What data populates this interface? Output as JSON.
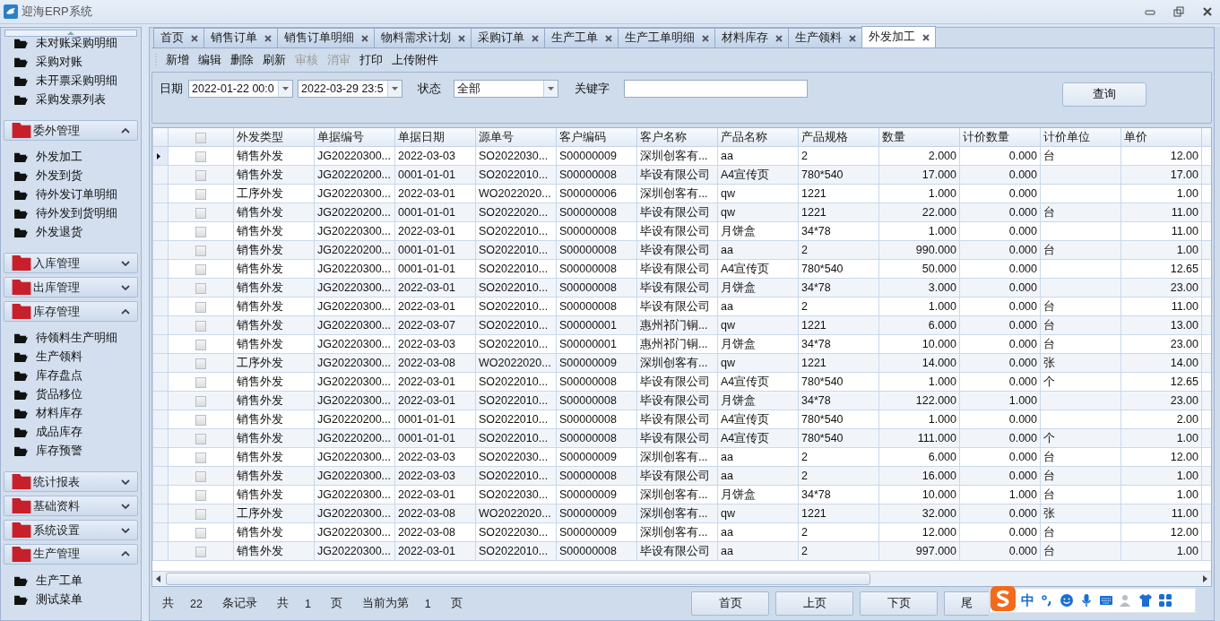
{
  "window": {
    "title": "迎海ERP系统"
  },
  "sidebar": {
    "top_items": [
      "未对账采购明细",
      "采购对账",
      "未开票采购明细",
      "采购发票列表"
    ],
    "groups": [
      {
        "label": "委外管理",
        "expanded": true,
        "items": [
          "外发加工",
          "外发到货",
          "待外发订单明细",
          "待外发到货明细",
          "外发退货"
        ]
      },
      {
        "label": "入库管理",
        "expanded": false
      },
      {
        "label": "出库管理",
        "expanded": false
      },
      {
        "label": "库存管理",
        "expanded": true,
        "items": [
          "待领料生产明细",
          "生产领料",
          "库存盘点",
          "货品移位",
          "材料库存",
          "成品库存",
          "库存预警"
        ]
      },
      {
        "label": "统计报表",
        "expanded": false
      },
      {
        "label": "基础资料",
        "expanded": false
      },
      {
        "label": "系统设置",
        "expanded": false
      },
      {
        "label": "生产管理",
        "expanded": true,
        "items": [
          "生产工单",
          "测试菜单"
        ]
      }
    ]
  },
  "tabs": [
    {
      "label": "首页",
      "selected": false
    },
    {
      "label": "销售订单",
      "selected": false
    },
    {
      "label": "销售订单明细",
      "selected": false
    },
    {
      "label": "物料需求计划",
      "selected": false
    },
    {
      "label": "采购订单",
      "selected": false
    },
    {
      "label": "生产工单",
      "selected": false
    },
    {
      "label": "生产工单明细",
      "selected": false
    },
    {
      "label": "材料库存",
      "selected": false
    },
    {
      "label": "生产领料",
      "selected": false
    },
    {
      "label": "外发加工",
      "selected": true
    }
  ],
  "toolbar": [
    {
      "label": "新增",
      "disabled": false
    },
    {
      "label": "编辑",
      "disabled": false
    },
    {
      "label": "删除",
      "disabled": false
    },
    {
      "label": "刷新",
      "disabled": false
    },
    {
      "label": "审核",
      "disabled": true
    },
    {
      "label": "消审",
      "disabled": true
    },
    {
      "label": "打印",
      "disabled": false
    },
    {
      "label": "上传附件",
      "disabled": false
    }
  ],
  "filter": {
    "date_label": "日期",
    "date_from": "2022-01-22 00:0",
    "date_to": "2022-03-29 23:5",
    "status_label": "状态",
    "status": "全部",
    "keyword_label": "关键字",
    "query_button": "查询"
  },
  "table": {
    "header_checked": false,
    "columns": [
      {
        "label": "外发类型",
        "kind": "text"
      },
      {
        "label": "单据编号",
        "kind": "text"
      },
      {
        "label": "单据日期",
        "kind": "text"
      },
      {
        "label": "源单号",
        "kind": "text"
      },
      {
        "label": "客户编码",
        "kind": "text"
      },
      {
        "label": "客户名称",
        "kind": "text"
      },
      {
        "label": "产品名称",
        "kind": "text"
      },
      {
        "label": "产品规格",
        "kind": "text"
      },
      {
        "label": "数量",
        "kind": "number"
      },
      {
        "label": "计价数量",
        "kind": "number"
      },
      {
        "label": "计价单位",
        "kind": "text"
      },
      {
        "label": "单价",
        "kind": "number"
      }
    ],
    "rows": [
      {
        "current": true,
        "checked": false,
        "cells": [
          "销售外发",
          "JG20220300...",
          "2022-03-03",
          "SO2022030...",
          "S00000009",
          "深圳创客有...",
          "aa",
          "2",
          "2.000",
          "0.000",
          "台",
          "12.00"
        ]
      },
      {
        "current": false,
        "checked": false,
        "cells": [
          "销售外发",
          "JG20220200...",
          "0001-01-01",
          "SO2022010...",
          "S00000008",
          "毕设有限公司",
          "A4宣传页",
          "780*540",
          "17.000",
          "0.000",
          null,
          "17.00"
        ]
      },
      {
        "current": false,
        "checked": false,
        "cells": [
          "工序外发",
          "JG20220300...",
          "2022-03-01",
          "WO2022020...",
          "S00000006",
          "深圳创客有...",
          "qw",
          "1221",
          "1.000",
          "0.000",
          null,
          "1.00"
        ]
      },
      {
        "current": false,
        "checked": false,
        "cells": [
          "销售外发",
          "JG20220200...",
          "0001-01-01",
          "SO2022020...",
          "S00000008",
          "毕设有限公司",
          "qw",
          "1221",
          "22.000",
          "0.000",
          "台",
          "11.00"
        ]
      },
      {
        "current": false,
        "checked": false,
        "cells": [
          "销售外发",
          "JG20220300...",
          "2022-03-01",
          "SO2022010...",
          "S00000008",
          "毕设有限公司",
          "月饼盒",
          "34*78",
          "1.000",
          "0.000",
          null,
          "11.00"
        ]
      },
      {
        "current": false,
        "checked": false,
        "cells": [
          "销售外发",
          "JG20220200...",
          "0001-01-01",
          "SO2022010...",
          "S00000008",
          "毕设有限公司",
          "aa",
          "2",
          "990.000",
          "0.000",
          "台",
          "1.00"
        ]
      },
      {
        "current": false,
        "checked": false,
        "cells": [
          "销售外发",
          "JG20220300...",
          "0001-01-01",
          "SO2022010...",
          "S00000008",
          "毕设有限公司",
          "A4宣传页",
          "780*540",
          "50.000",
          "0.000",
          null,
          "12.65"
        ]
      },
      {
        "current": false,
        "checked": false,
        "cells": [
          "销售外发",
          "JG20220300...",
          "2022-03-01",
          "SO2022010...",
          "S00000008",
          "毕设有限公司",
          "月饼盒",
          "34*78",
          "3.000",
          "0.000",
          null,
          "23.00"
        ]
      },
      {
        "current": false,
        "checked": false,
        "cells": [
          "销售外发",
          "JG20220300...",
          "2022-03-01",
          "SO2022010...",
          "S00000008",
          "毕设有限公司",
          "aa",
          "2",
          "1.000",
          "0.000",
          "台",
          "11.00"
        ]
      },
      {
        "current": false,
        "checked": false,
        "cells": [
          "销售外发",
          "JG20220300...",
          "2022-03-07",
          "SO2022010...",
          "S00000001",
          "惠州祁门铜...",
          "qw",
          "1221",
          "6.000",
          "0.000",
          "台",
          "13.00"
        ]
      },
      {
        "current": false,
        "checked": false,
        "cells": [
          "销售外发",
          "JG20220300...",
          "2022-03-03",
          "SO2022010...",
          "S00000001",
          "惠州祁门铜...",
          "月饼盒",
          "34*78",
          "10.000",
          "0.000",
          "台",
          "23.00"
        ]
      },
      {
        "current": false,
        "checked": false,
        "cells": [
          "工序外发",
          "JG20220300...",
          "2022-03-08",
          "WO2022020...",
          "S00000009",
          "深圳创客有...",
          "qw",
          "1221",
          "14.000",
          "0.000",
          "张",
          "14.00"
        ]
      },
      {
        "current": false,
        "checked": false,
        "cells": [
          "销售外发",
          "JG20220300...",
          "2022-03-01",
          "SO2022010...",
          "S00000008",
          "毕设有限公司",
          "A4宣传页",
          "780*540",
          "1.000",
          "0.000",
          "个",
          "12.65"
        ]
      },
      {
        "current": false,
        "checked": false,
        "cells": [
          "销售外发",
          "JG20220300...",
          "2022-03-01",
          "SO2022010...",
          "S00000008",
          "毕设有限公司",
          "月饼盒",
          "34*78",
          "122.000",
          "1.000",
          null,
          "23.00"
        ]
      },
      {
        "current": false,
        "checked": false,
        "cells": [
          "销售外发",
          "JG20220200...",
          "0001-01-01",
          "SO2022010...",
          "S00000008",
          "毕设有限公司",
          "A4宣传页",
          "780*540",
          "1.000",
          "0.000",
          null,
          "2.00"
        ]
      },
      {
        "current": false,
        "checked": false,
        "cells": [
          "销售外发",
          "JG20220200...",
          "0001-01-01",
          "SO2022010...",
          "S00000008",
          "毕设有限公司",
          "A4宣传页",
          "780*540",
          "111.000",
          "0.000",
          "个",
          "1.00"
        ]
      },
      {
        "current": false,
        "checked": false,
        "cells": [
          "销售外发",
          "JG20220300...",
          "2022-03-03",
          "SO2022030...",
          "S00000009",
          "深圳创客有...",
          "aa",
          "2",
          "6.000",
          "0.000",
          "台",
          "12.00"
        ]
      },
      {
        "current": false,
        "checked": false,
        "cells": [
          "销售外发",
          "JG20220300...",
          "2022-03-03",
          "SO2022010...",
          "S00000008",
          "毕设有限公司",
          "aa",
          "2",
          "16.000",
          "0.000",
          "台",
          "1.00"
        ]
      },
      {
        "current": false,
        "checked": false,
        "cells": [
          "销售外发",
          "JG20220300...",
          "2022-03-01",
          "SO2022030...",
          "S00000009",
          "深圳创客有...",
          "月饼盒",
          "34*78",
          "10.000",
          "1.000",
          "台",
          "1.00"
        ]
      },
      {
        "current": false,
        "checked": false,
        "cells": [
          "工序外发",
          "JG20220300...",
          "2022-03-08",
          "WO2022020...",
          "S00000009",
          "深圳创客有...",
          "qw",
          "1221",
          "32.000",
          "0.000",
          "张",
          "11.00"
        ]
      },
      {
        "current": false,
        "checked": false,
        "cells": [
          "销售外发",
          "JG20220300...",
          "2022-03-08",
          "SO2022030...",
          "S00000009",
          "深圳创客有...",
          "aa",
          "2",
          "12.000",
          "0.000",
          "台",
          "12.00"
        ]
      },
      {
        "current": false,
        "checked": false,
        "cells": [
          "销售外发",
          "JG20220300...",
          "2022-03-01",
          "SO2022010...",
          "S00000008",
          "毕设有限公司",
          "aa",
          "2",
          "997.000",
          "0.000",
          "台",
          "1.00"
        ]
      }
    ]
  },
  "footer": {
    "total_prefix": "共",
    "total_records": "22",
    "records_label": "条记录",
    "pages_prefix": "共",
    "total_pages": "1",
    "pages_label": "页",
    "current_label": "当前为第",
    "current_page": "1",
    "current_suffix": "页"
  },
  "pager_buttons": [
    "首页",
    "上页",
    "下页",
    "尾"
  ],
  "ime_bar": {
    "mode": "中"
  }
}
